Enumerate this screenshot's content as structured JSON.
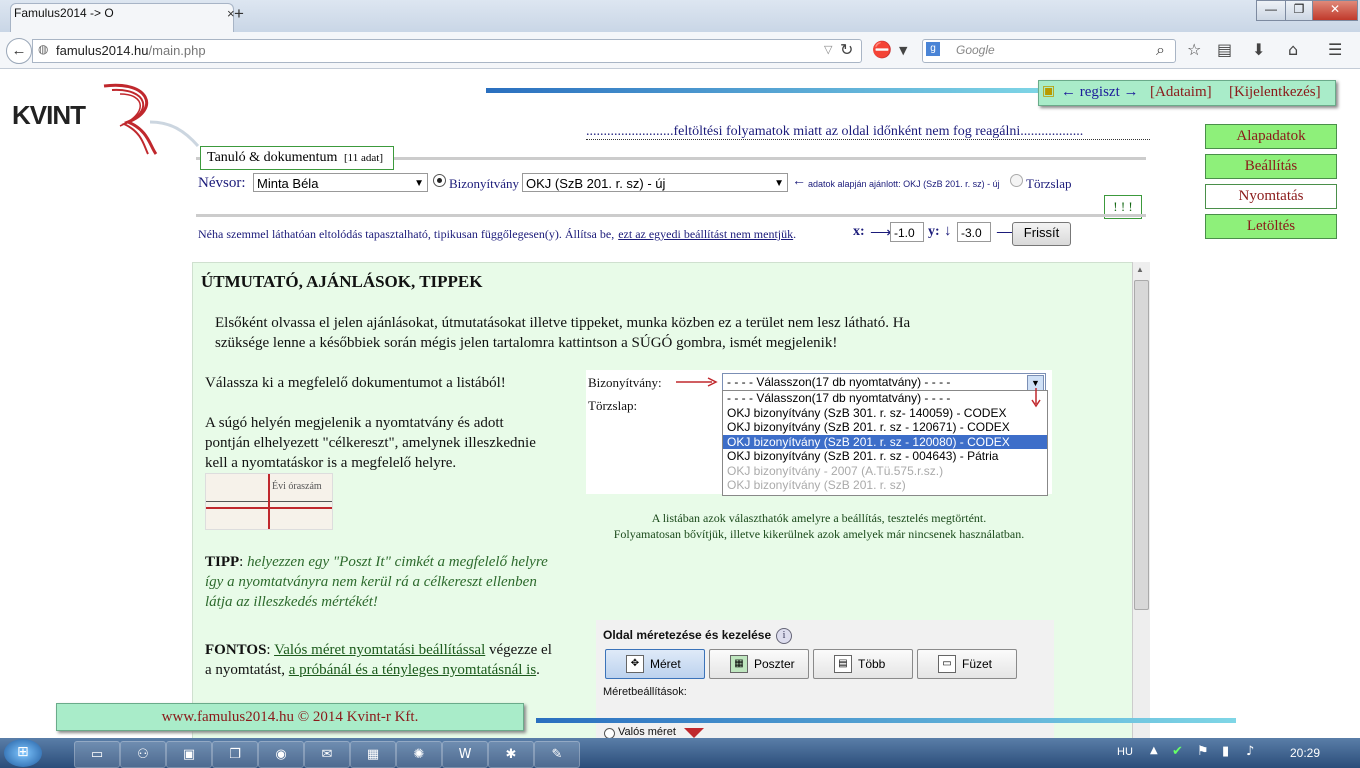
{
  "browser": {
    "tab_title": "Famulus2014 -> O",
    "url_host": "famulus2014.hu",
    "url_path": "/main.php",
    "search_placeholder": "Google",
    "window_controls": {
      "minimize": "—",
      "maximize": "❐",
      "close": "✕"
    }
  },
  "header": {
    "logo": "KVINT",
    "auth": {
      "regiszt": "← regiszt →",
      "adataim": "[Adataim]",
      "kijelentkezes": "[Kijelentkezés]"
    },
    "notice": ".........................feltöltési folyamatok miatt az oldal időnként nem fog reagálni.................."
  },
  "panel": {
    "title": "Tanuló & dokumentum",
    "count": "[11 adat]",
    "nevsor_label": "Névsor:",
    "nevsor_value": "Minta Béla",
    "radio_bizonyitvany": "Bizonyítvány",
    "doc_value": "OKJ (SzB 201. r. sz) - új",
    "hint_arrow": "←",
    "hint": "adatok alapján ajánlott: OKJ (SzB 201. r. sz) - új",
    "radio_torzslap": "Törzslap",
    "warn": "! ! !",
    "shift_text": "Néha szemmel láthatóan eltolódás tapasztalható, tipikusan függőlegesen(y). Állítsa be,",
    "shift_link": "ezt az egyedi beállítást nem mentjük",
    "shift_dot": ".",
    "x_label": "x:",
    "x_arrow": "⟶",
    "x_value": "-1.0",
    "y_label": "y:",
    "y_arrow": "↓",
    "y_value": "-3.0",
    "go_arrow": "⟶",
    "refresh": "Frissít"
  },
  "side_menu": [
    "Alapadatok",
    "Beállítás",
    "Nyomtatás",
    "Letöltés"
  ],
  "content": {
    "heading": "ÚTMUTATÓ, AJÁNLÁSOK, TIPPEK",
    "intro_1": "Elsőként olvassa el jelen ajánlásokat, útmutatásokat illetve tippeket, munka közben ez a terület nem lesz látható. Ha",
    "intro_2": "szüksége lenne a későbbiek során mégis jelen tartalomra kattintson a SÚGÓ gombra, ismét megjelenik!",
    "p_select": "Válassza ki a megfelelő dokumentumot a  listából!",
    "p_sugo_1": "A súgó helyén megjelenik a nyomtatvány  és adott",
    "p_sugo_2": "pontján elhelyezett \"célkereszt\", amelynek illeszkednie",
    "p_sugo_3": "kell a nyomtatáskor is a megfelelő helyre.",
    "thumb_label": "Évi óraszám",
    "tipp_label": "TIPP",
    "tipp_1": "helyezzen egy \"Poszt It\" cimkét a megfelelő helyre",
    "tipp_2": "így a nyomtatványra  nem kerül rá a célkereszt ellenben",
    "tipp_3": "látja az illeszkedés mértékét!",
    "fontos_label": "FONTOS",
    "fontos_link1": "Valós méret nyomtatási beállítással",
    "fontos_mid": "végezze el",
    "fontos_2a": "a nyomtatást,",
    "fontos_link2": "a próbánál és a tényleges nyomtatásnál is",
    "fontos_end": "."
  },
  "demo": {
    "label_biz": "Bizonyítvány:",
    "label_torzs": "Törzslap:",
    "select_value": "- - - - Válasszon(17 db nyomtatvány) - - - -",
    "options": [
      {
        "label": "- - - - Válasszon(17 db nyomtatvány) - - - -",
        "state": "normal"
      },
      {
        "label": "OKJ bizonyítvány (SzB 301. r. sz- 140059) - CODEX",
        "state": "normal"
      },
      {
        "label": "OKJ bizonyítvány (SzB 201. r. sz - 120671) - CODEX",
        "state": "normal"
      },
      {
        "label": "OKJ bizonyítvány (SzB 201. r. sz - 120080) - CODEX",
        "state": "selected"
      },
      {
        "label": "OKJ bizonyítvány (SzB 201. r. sz - 004643) - Pátria",
        "state": "normal"
      },
      {
        "label": "OKJ bizonyítvány - 2007 (A.Tü.575.r.sz.)",
        "state": "disabled"
      },
      {
        "label": "OKJ bizonyítvány (SzB 201. r. sz)",
        "state": "disabled"
      }
    ],
    "note_1": "A listában azok választhatók amelyre a beállítás, tesztelés megtörtént.",
    "note_2": "Folyamatosan bővítjük, illetve kikerülnek azok amelyek már nincsenek használatban."
  },
  "print_panel": {
    "title": "Oldal méretezése és kezelése",
    "buttons": [
      "Méret",
      "Poszter",
      "Több",
      "Füzet"
    ],
    "meret_beall": "Méretbeállítások:",
    "valos_meret": "Valós méret"
  },
  "footer": {
    "text": "www.famulus2014.hu © 2014 Kvint-r Kft."
  },
  "taskbar": {
    "lang": "HU",
    "time": "20:29"
  }
}
